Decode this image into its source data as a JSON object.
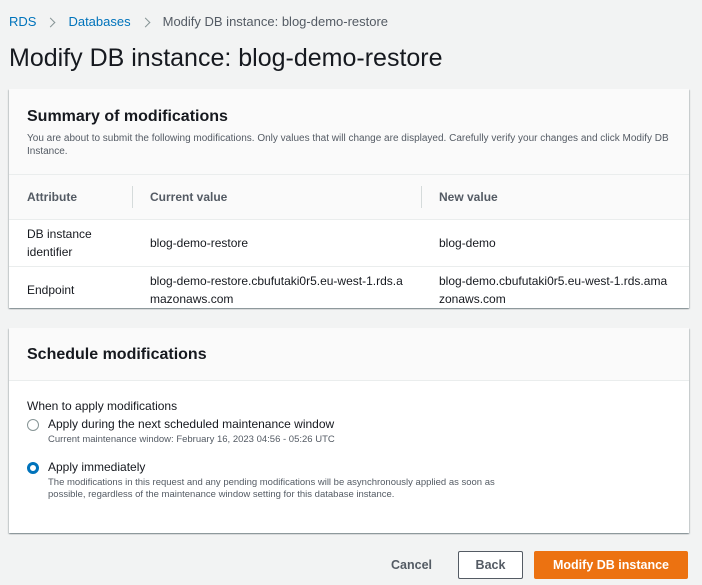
{
  "breadcrumb": {
    "items": [
      "RDS",
      "Databases"
    ],
    "current": "Modify DB instance: blog-demo-restore"
  },
  "page_title": "Modify DB instance: blog-demo-restore",
  "summary": {
    "title": "Summary of modifications",
    "description": "You are about to submit the following modifications. Only values that will change are displayed. Carefully verify your changes and click Modify DB Instance.",
    "columns": [
      "Attribute",
      "Current value",
      "New value"
    ],
    "rows": [
      {
        "attribute": "DB instance identifier",
        "current": "blog-demo-restore",
        "new": "blog-demo"
      },
      {
        "attribute": "Endpoint",
        "current": "blog-demo-restore.cbufutaki0r5.eu-west-1.rds.amazonaws.com",
        "new": "blog-demo.cbufutaki0r5.eu-west-1.rds.amazonaws.com"
      }
    ]
  },
  "schedule": {
    "title": "Schedule modifications",
    "field_label": "When to apply modifications",
    "options": [
      {
        "label": "Apply during the next scheduled maintenance window",
        "description": "Current maintenance window: February 16, 2023 04:56 - 05:26 UTC",
        "selected": false
      },
      {
        "label": "Apply immediately",
        "description": "The modifications in this request and any pending modifications will be asynchronously applied as soon as possible, regardless of the maintenance window setting for this database instance.",
        "selected": true
      }
    ]
  },
  "actions": {
    "cancel": "Cancel",
    "back": "Back",
    "submit": "Modify DB instance"
  },
  "colors": {
    "link": "#0073bb",
    "primary_button": "#ec7211",
    "background": "#f2f3f3"
  }
}
